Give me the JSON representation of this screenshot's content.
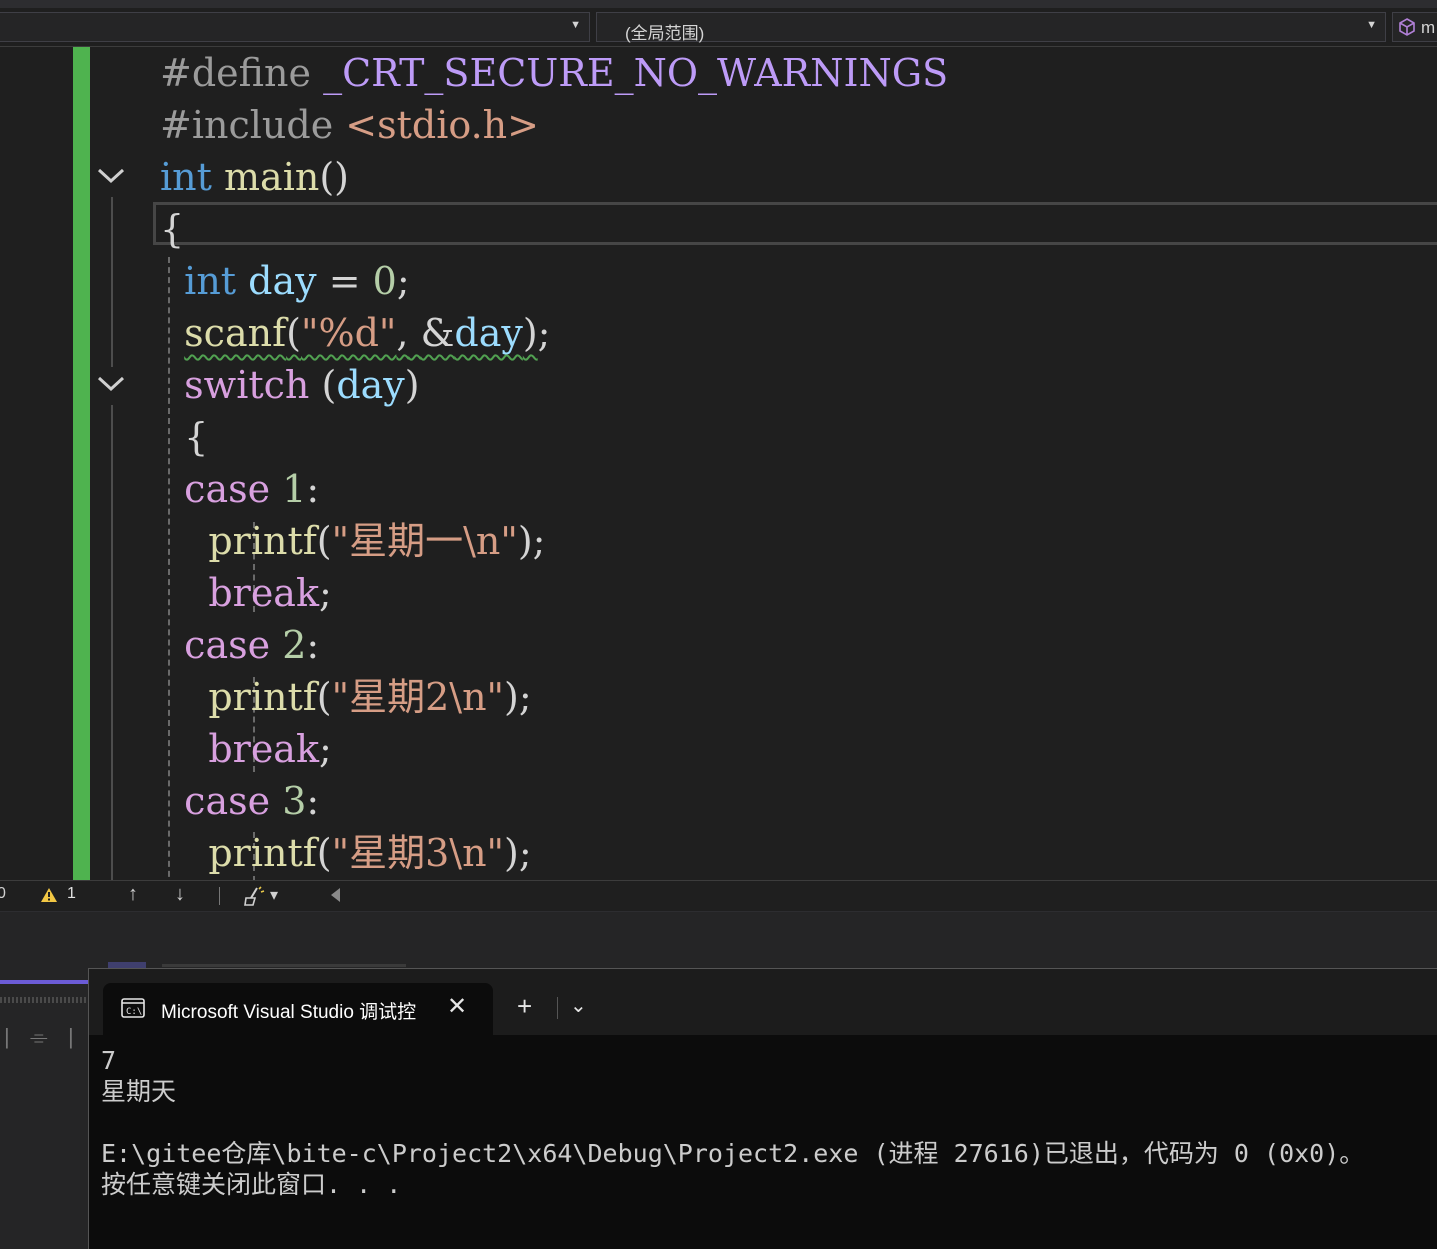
{
  "navbar": {
    "scope_label": "(全局范围)",
    "member_label": "m"
  },
  "code": {
    "line1": {
      "pp": "#define",
      "macro": "_CRT_SECURE_NO_WARNINGS"
    },
    "line2": {
      "pp": "#include",
      "header": "<stdio.h>"
    },
    "line3": {
      "type": "int",
      "func": "main",
      "parens": "()"
    },
    "line4": {
      "brace": "{"
    },
    "line5": {
      "type": "int",
      "var": "day",
      "eq": "=",
      "value": "0",
      "semi": ";"
    },
    "line6": {
      "func": "scanf",
      "open": "(",
      "fmt": "\"%d\"",
      "comma": ",",
      "amp": "&",
      "var": "day",
      "close": ")",
      "semi": ";"
    },
    "line7": {
      "kw": "switch",
      "open": "(",
      "var": "day",
      "close": ")"
    },
    "line8": {
      "brace": "{"
    },
    "case1": {
      "kw": "case",
      "num": "1",
      "colon": ":"
    },
    "printf1": {
      "func": "printf",
      "open": "(",
      "str": "\"星期一\\n\"",
      "close": ")",
      "semi": ";"
    },
    "break1": {
      "kw": "break",
      "semi": ";"
    },
    "case2": {
      "kw": "case",
      "num": "2",
      "colon": ":"
    },
    "printf2": {
      "func": "printf",
      "open": "(",
      "str": "\"星期2\\n\"",
      "close": ")",
      "semi": ";"
    },
    "break2": {
      "kw": "break",
      "semi": ";"
    },
    "case3": {
      "kw": "case",
      "num": "3",
      "colon": ":"
    },
    "printf3": {
      "func": "printf",
      "open": "(",
      "str": "\"星期3\\n\"",
      "close": ")",
      "semi": ";"
    }
  },
  "editor_status": {
    "left_fragment": "0",
    "warning_count": "1",
    "up_arrow": "↑",
    "down_arrow": "↓",
    "dropdown_caret": "▾"
  },
  "terminal": {
    "tab_title": "Microsoft Visual Studio 调试控",
    "close_glyph": "✕",
    "new_tab_glyph": "+",
    "dropdown_glyph": "⌄",
    "output": [
      "7",
      "星期天",
      "",
      "E:\\gitee仓库\\bite-c\\Project2\\x64\\Debug\\Project2.exe (进程 27616)已退出，代码为 0 (0x0)。",
      "按任意键关闭此窗口. . ."
    ]
  },
  "colors": {
    "change_bar": "#4fb34f",
    "keyword": "#569cd6",
    "function": "#dcdcaa",
    "variable": "#9cdcfe",
    "number": "#b5cea8",
    "string": "#d69d85",
    "control": "#d8a0df",
    "macro": "#bd9bf7",
    "squiggle": "#51a151"
  }
}
